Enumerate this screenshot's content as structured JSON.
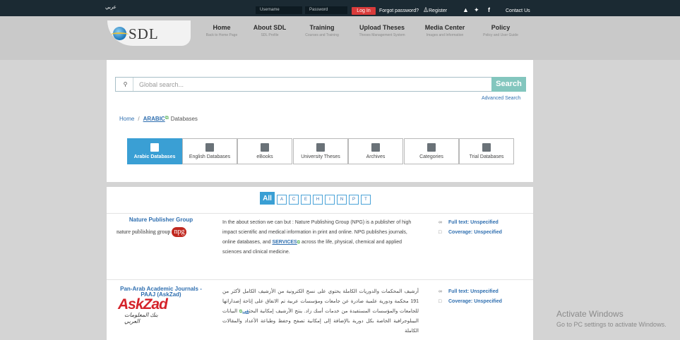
{
  "topbar": {
    "lang": "عربي",
    "username_placeholder": "Username",
    "password_placeholder": "Password",
    "login": "Log In",
    "forgot": "Forgot password?",
    "register": "Register",
    "contact": "Contact Us"
  },
  "logo": {
    "text": "SDL"
  },
  "nav": [
    {
      "title": "Home",
      "sub": "Back to Home Page"
    },
    {
      "title": "About SDL",
      "sub": "SDL Profile"
    },
    {
      "title": "Training",
      "sub": "Courses and Training"
    },
    {
      "title": "Upload Theses",
      "sub": "Theses Management System"
    },
    {
      "title": "Media Center",
      "sub": "Images and Information"
    },
    {
      "title": "Policy",
      "sub": "Policy and User Guide"
    }
  ],
  "search": {
    "placeholder": "Global search...",
    "button": "Search",
    "advanced": "Advanced Search"
  },
  "breadcrumb": {
    "home": "Home",
    "section": "ARABIC",
    "current": "Databases"
  },
  "tiles": [
    {
      "label": "Arabic Databases",
      "active": true
    },
    {
      "label": "English Databases",
      "active": false
    },
    {
      "label": "eBooks",
      "active": false
    },
    {
      "label": "University Theses",
      "active": false
    },
    {
      "label": "Archives",
      "active": false
    },
    {
      "label": "Categories",
      "active": false
    },
    {
      "label": "Trial Databases",
      "active": false
    }
  ],
  "letters": {
    "all": "All",
    "items": [
      "A",
      "C",
      "E",
      "H",
      "I",
      "N",
      "P",
      "T"
    ]
  },
  "entries": [
    {
      "name": "Nature Publisher Group",
      "logo_text": "nature publishing group",
      "logo_badge": "npg",
      "desc_before": "In the about section we can but : Nature Publishing Group (NPG) is a publisher of high impact scientific and medical information in print and online. NPG publishes journals, online databases, and ",
      "desc_link": "SERVICES",
      "desc_after": " across the life, physical, chemical and applied sciences and clinical medicine.",
      "fulltext_label": "Full text:",
      "fulltext_value": "Unspecified",
      "coverage_label": "Coverage:",
      "coverage_value": "Unspecified"
    },
    {
      "name": "Pan-Arab Academic Journals - PAAJ (AskZad)",
      "logo_text": "AskZad",
      "logo_sub": "بنك المعلومات العربي",
      "desc_before": "أرشيف المحكمات والدوريات الكاملة يحتوي على نسخ الكترونية من الأرشيف الكامل لأكثر من 191 محكمة ودورية علمية صادرة عن جامعات ومؤسسات عربية تم الاتفاق على إتاحة إصداراتها للجامعات والمؤسسات المستفيدة من خدمات أسك زاد. ينتج الأرشيف إمكانية البحث",
      "desc_link": "في",
      "desc_after": " البيانات البيبلوجرافية الخاصة بكل دورية بالإضافة إلى إمكانية تصفح وحفظ وطباعة الأعداد والمقالات الكاملة",
      "fulltext_label": "Full text:",
      "fulltext_value": "Unspecified",
      "coverage_label": "Coverage:",
      "coverage_value": "Unspecified"
    }
  ],
  "watermark": {
    "line1": "Activate Windows",
    "line2": "Go to PC settings to activate Windows."
  },
  "colors": {
    "topbar": "#1b2a33",
    "accent": "#3a9fd4",
    "login": "#d93b3b",
    "search_button": "#83c6be",
    "link": "#2f6fb0"
  }
}
